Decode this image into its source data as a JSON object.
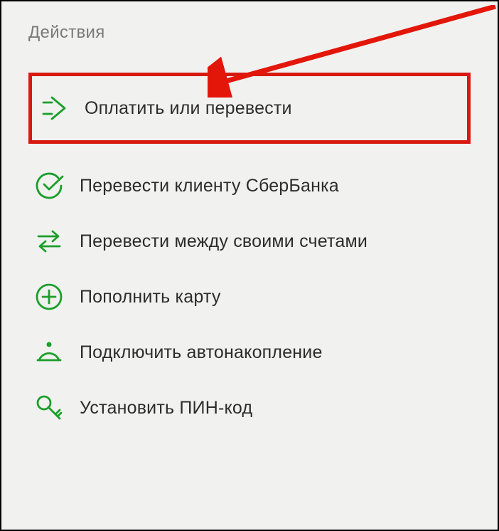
{
  "section_title": "Действия",
  "accent_color": "#1a9f29",
  "highlight_color": "#d8190d",
  "actions": [
    {
      "icon": "pay-arrow-icon",
      "label": "Оплатить или перевести",
      "highlighted": true
    },
    {
      "icon": "check-circle-icon",
      "label": "Перевести клиенту СберБанка",
      "highlighted": false
    },
    {
      "icon": "swap-arrows-icon",
      "label": "Перевести между своими счетами",
      "highlighted": false
    },
    {
      "icon": "plus-circle-icon",
      "label": "Пополнить карту",
      "highlighted": false
    },
    {
      "icon": "piggy-bank-icon",
      "label": "Подключить автонакопление",
      "highlighted": false
    },
    {
      "icon": "key-icon",
      "label": "Установить ПИН-код",
      "highlighted": false
    }
  ]
}
